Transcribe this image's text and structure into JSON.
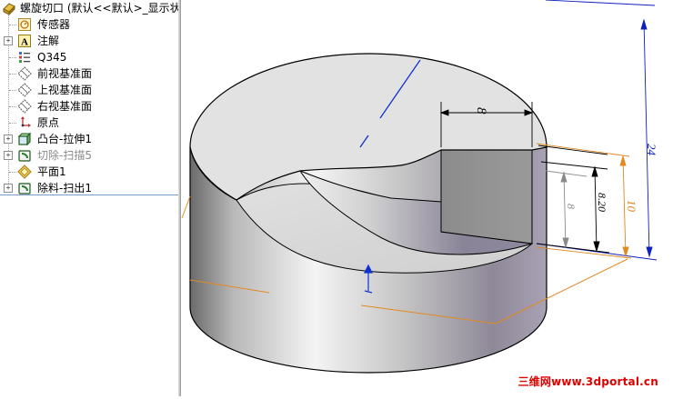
{
  "tree": {
    "root_label": "螺旋切口 (默认<<默认>_显示状",
    "items": [
      {
        "label": "传感器",
        "icon": "sensor-icon",
        "expandable": false,
        "dimmed": false
      },
      {
        "label": "注解",
        "icon": "annotation-icon",
        "expandable": true,
        "dimmed": false
      },
      {
        "label": "Q345",
        "icon": "material-icon",
        "expandable": false,
        "dimmed": false
      },
      {
        "label": "前视基准面",
        "icon": "plane-icon",
        "expandable": false,
        "dimmed": false
      },
      {
        "label": "上视基准面",
        "icon": "plane-icon",
        "expandable": false,
        "dimmed": false
      },
      {
        "label": "右视基准面",
        "icon": "plane-icon",
        "expandable": false,
        "dimmed": false
      },
      {
        "label": "原点",
        "icon": "origin-icon",
        "expandable": false,
        "dimmed": false
      },
      {
        "label": "凸台-拉伸1",
        "icon": "boss-extrude-icon",
        "expandable": true,
        "dimmed": false
      },
      {
        "label": "切除-扫描5",
        "icon": "cut-sweep-icon",
        "expandable": true,
        "dimmed": true
      },
      {
        "label": "平面1",
        "icon": "plane-feature-icon",
        "expandable": false,
        "dimmed": false
      },
      {
        "label": "除料-扫出1",
        "icon": "cut-sweep-icon",
        "expandable": true,
        "dimmed": false
      }
    ]
  },
  "viewport": {
    "dimensions": {
      "slot_width": "8",
      "slot_depth_left": "8",
      "depth": "8.20",
      "step_height": "10",
      "total_height": "24"
    },
    "colors": {
      "dimension_blue": "#1020c0",
      "dimension_orange": "#e08a20",
      "dimension_black": "#000000",
      "dimension_gray": "#8a8a8a",
      "axis_blue": "#1030d0"
    }
  },
  "watermark": "三维网www.3dportal.cn"
}
